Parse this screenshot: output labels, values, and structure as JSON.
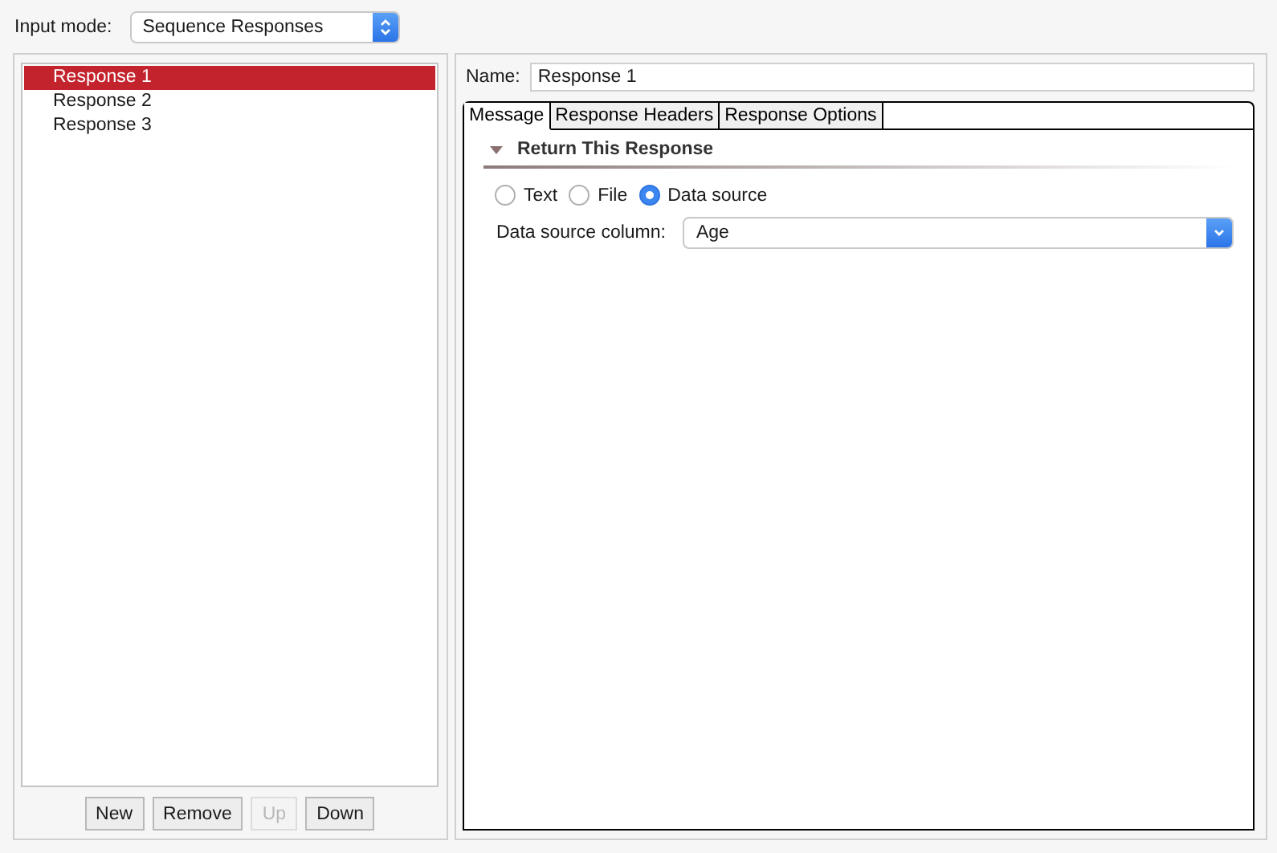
{
  "input_mode": {
    "label": "Input mode:",
    "value": "Sequence Responses"
  },
  "responses": [
    {
      "label": "Response 1",
      "selected": true
    },
    {
      "label": "Response 2",
      "selected": false
    },
    {
      "label": "Response 3",
      "selected": false
    }
  ],
  "list_buttons": [
    {
      "label": "New",
      "disabled": false
    },
    {
      "label": "Remove",
      "disabled": false
    },
    {
      "label": "Up",
      "disabled": true
    },
    {
      "label": "Down",
      "disabled": false
    }
  ],
  "name_field": {
    "label": "Name:",
    "value": "Response 1"
  },
  "tabs": [
    {
      "label": "Message",
      "selected": true
    },
    {
      "label": "Response Headers",
      "selected": false
    },
    {
      "label": "Response Options",
      "selected": false
    }
  ],
  "section": {
    "title": "Return This Response",
    "expanded": true
  },
  "source_options": [
    {
      "label": "Text",
      "selected": false
    },
    {
      "label": "File",
      "selected": false
    },
    {
      "label": "Data source",
      "selected": true
    }
  ],
  "data_source_column": {
    "label": "Data source column:",
    "value": "Age"
  }
}
